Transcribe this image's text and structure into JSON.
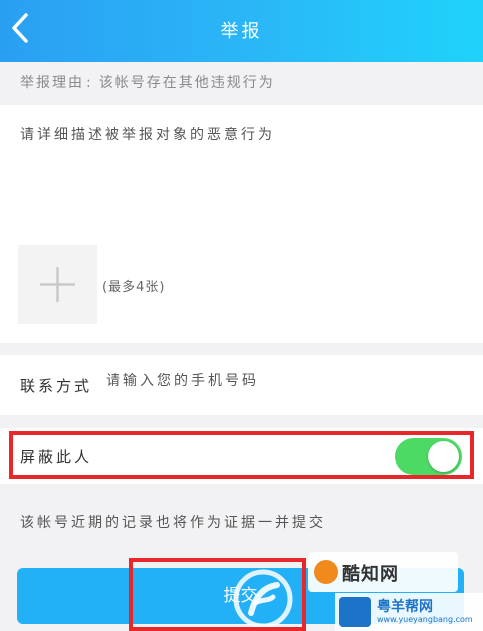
{
  "header": {
    "title": "举报",
    "back_icon": "chevron-left-icon"
  },
  "reason": {
    "label": "举报理由",
    "separator": ":",
    "value": "该帐号存在其他违规行为"
  },
  "description": {
    "placeholder": "请详细描述被举报对象的恶意行为"
  },
  "photos": {
    "add_icon": "plus-icon",
    "hint": "(最多4张)"
  },
  "contact": {
    "label": "联系方式",
    "placeholder": "请输入您的手机号码"
  },
  "block_user": {
    "label": "屏蔽此人",
    "enabled": true,
    "on_color": "#4cd964"
  },
  "note": "该帐号近期的记录也将作为证据一并提交",
  "submit": {
    "label": "提交",
    "color": "#22b0f6"
  },
  "watermark": {
    "brand": "酷知网",
    "site_name": "粤羊帮网",
    "site_url": "www.yueyangbang.com"
  },
  "colors": {
    "header_gradient": [
      "#2a9ff2",
      "#1fd3fb"
    ],
    "highlight": "#e8272b"
  }
}
